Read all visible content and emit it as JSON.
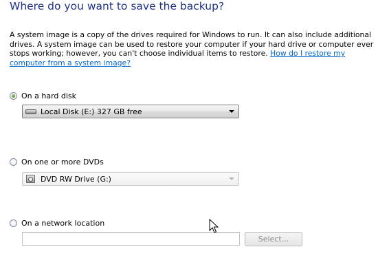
{
  "page": {
    "title": "Where do you want to save the backup?",
    "description": "A system image is a copy of the drives required for Windows to run. It can also include additional drives. A system image can be used to restore your computer if your hard drive or computer ever stops working; however, you can't choose individual items to restore.",
    "help_link": "How do I restore my computer from a system image?"
  },
  "options": {
    "hard_disk": {
      "label": "On a hard disk",
      "selected": true,
      "drive": "Local Disk (E:)  327 GB free",
      "icon": "hard-drive-icon"
    },
    "dvds": {
      "label": "On one or more DVDs",
      "selected": false,
      "drive": "DVD RW Drive (G:)",
      "icon": "dvd-drive-icon"
    },
    "network": {
      "label": "On a network location",
      "selected": false,
      "path": "",
      "select_button": "Select..."
    }
  },
  "colors": {
    "title": "#1e3287",
    "link": "#0066cc"
  }
}
